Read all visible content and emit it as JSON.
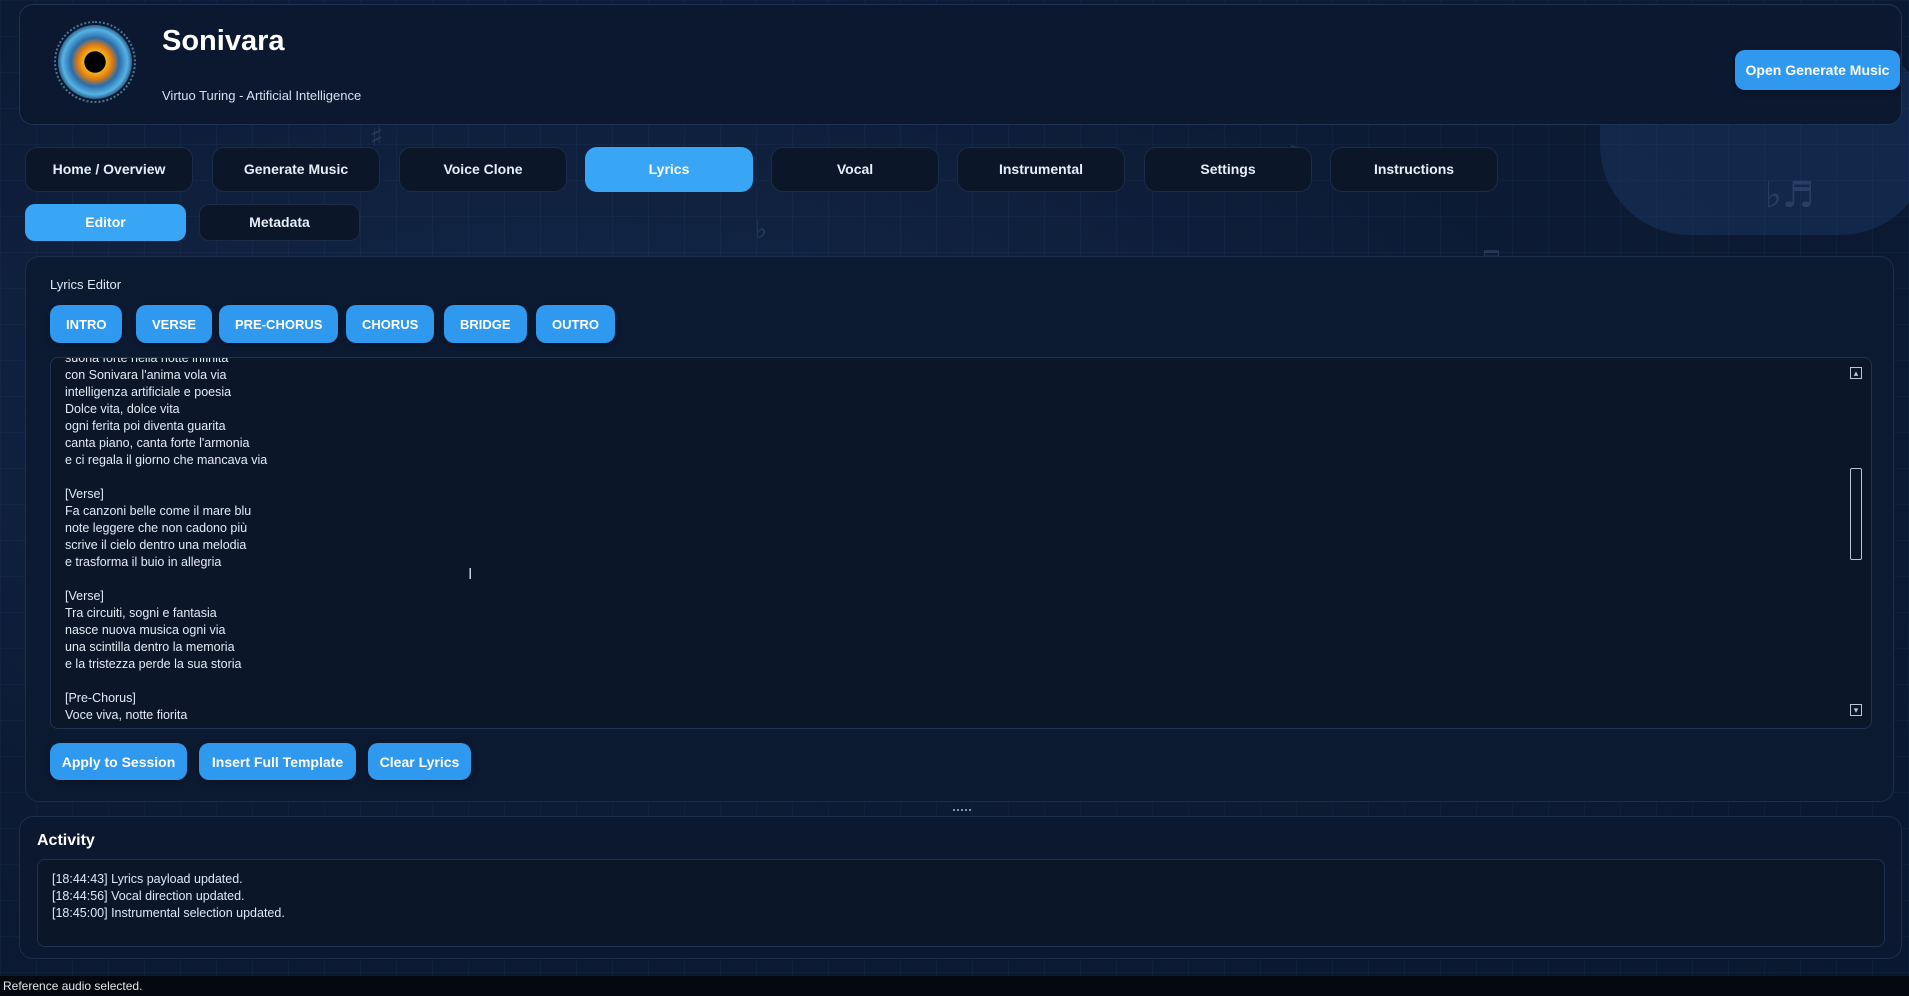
{
  "header": {
    "title": "Sonivara",
    "subtitle": "Virtuo Turing - Artificial Intelligence",
    "open_button": "Open Generate Music"
  },
  "main_tabs": [
    {
      "label": "Home / Overview",
      "active": false
    },
    {
      "label": "Generate Music",
      "active": false
    },
    {
      "label": "Voice Clone",
      "active": false
    },
    {
      "label": "Lyrics",
      "active": true
    },
    {
      "label": "Vocal",
      "active": false
    },
    {
      "label": "Instrumental",
      "active": false
    },
    {
      "label": "Settings",
      "active": false
    },
    {
      "label": "Instructions",
      "active": false
    }
  ],
  "sub_tabs": [
    {
      "label": "Editor",
      "active": true
    },
    {
      "label": "Metadata",
      "active": false
    }
  ],
  "editor": {
    "label": "Lyrics Editor",
    "section_buttons": [
      "INTRO",
      "VERSE",
      "PRE-CHORUS",
      "CHORUS",
      "BRIDGE",
      "OUTRO"
    ],
    "lyrics_text": "suona forte nella notte infinita\ncon Sonivara l'anima vola via\nintelligenza artificiale e poesia\nDolce vita, dolce vita\nogni ferita poi diventa guarita\ncanta piano, canta forte l'armonia\ne ci regala il giorno che mancava via\n\n[Verse]\nFa canzoni belle come il mare blu\nnote leggere che non cadono più\nscrive il cielo dentro una melodia\ne trasforma il buio in allegria\n\n[Verse]\nTra circuiti, sogni e fantasia\nnasce nuova musica ogni via\nuna scintilla dentro la memoria\ne la tristezza perde la sua storia\n\n[Pre-Chorus]\nVoce viva, notte fiorita",
    "actions": {
      "apply": "Apply to Session",
      "template": "Insert Full Template",
      "clear": "Clear Lyrics"
    }
  },
  "activity": {
    "title": "Activity",
    "log": [
      "[18:44:43] Lyrics payload updated.",
      "[18:44:56] Vocal direction updated.",
      "[18:45:00] Instrumental selection updated."
    ]
  },
  "status_bar": "Reference audio selected.",
  "colors": {
    "accent": "#38a5f5",
    "button": "#2f98ef",
    "background": "#0c1a33",
    "panel": "#0b1629"
  },
  "icons": {
    "logo": "iris-logo-icon",
    "scroll_up": "scroll-up-icon",
    "scroll_down": "scroll-down-icon",
    "cursor": "text-cursor-icon"
  }
}
